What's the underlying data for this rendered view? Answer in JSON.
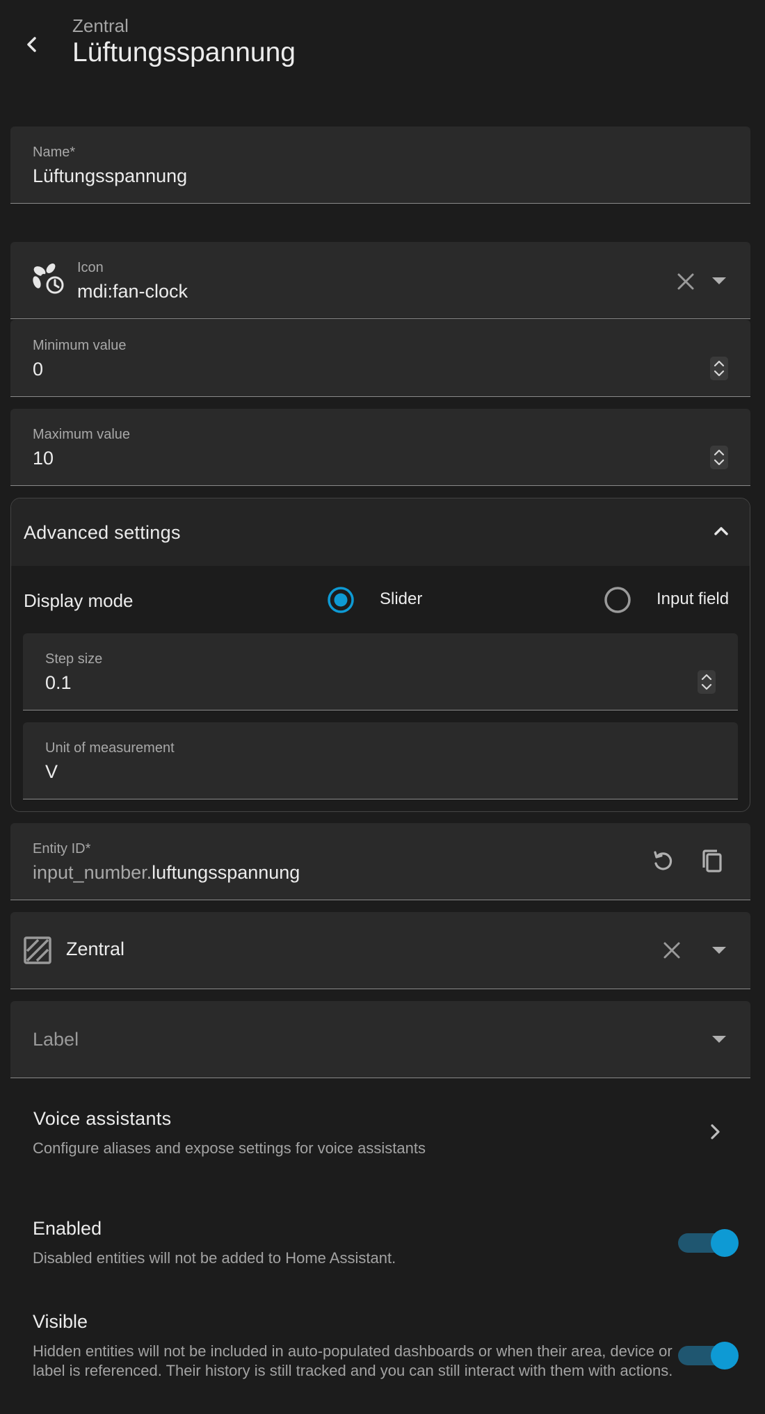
{
  "header": {
    "subtitle": "Zentral",
    "title": "Lüftungsspannung"
  },
  "name_field": {
    "label": "Name*",
    "value": "Lüftungsspannung"
  },
  "icon_field": {
    "label": "Icon",
    "value": "mdi:fan-clock",
    "icon": "fan-clock-icon"
  },
  "min_field": {
    "label": "Minimum value",
    "value": "0"
  },
  "max_field": {
    "label": "Maximum value",
    "value": "10"
  },
  "advanced": {
    "title": "Advanced settings",
    "display_mode_label": "Display mode",
    "options": [
      {
        "label": "Slider",
        "selected": true
      },
      {
        "label": "Input field",
        "selected": false
      }
    ],
    "step_field": {
      "label": "Step size",
      "value": "0.1"
    },
    "unit_field": {
      "label": "Unit of measurement",
      "value": "V"
    }
  },
  "entity_id": {
    "label": "Entity ID*",
    "prefix": "input_number.",
    "value": "luftungsspannung"
  },
  "area_field": {
    "value": "Zentral"
  },
  "label_field": {
    "placeholder": "Label"
  },
  "voice": {
    "title": "Voice assistants",
    "description": "Configure aliases and expose settings for voice assistants"
  },
  "enabled": {
    "title": "Enabled",
    "description": "Disabled entities will not be added to Home Assistant.",
    "on": true
  },
  "visible": {
    "title": "Visible",
    "description": "Hidden entities will not be included in auto-populated dashboards or when their area, device or label is referenced. Their history is still tracked and you can still interact with them with actions.",
    "on": true
  },
  "colors": {
    "background": "#1c1c1c",
    "field": "#2a2a2a",
    "accent": "#0e9ad4",
    "toggle_track": "#1f5670"
  }
}
